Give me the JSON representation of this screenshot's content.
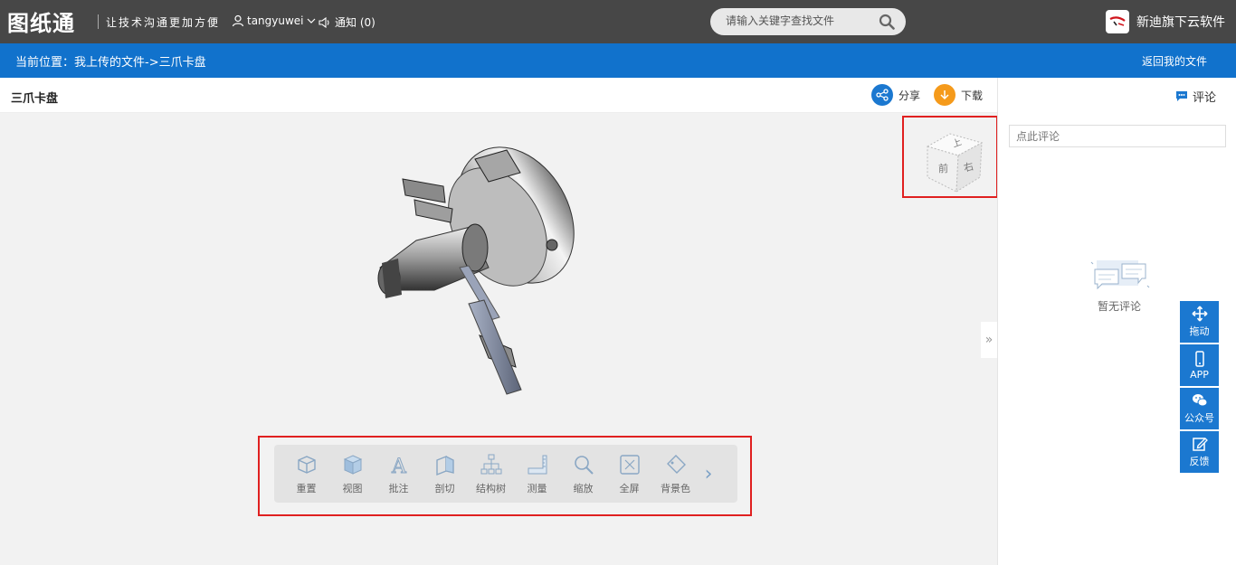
{
  "header": {
    "logo": "图纸通",
    "slogan": "让技术沟通更加方便",
    "username": "tangyuwei",
    "notification": "通知 (0)",
    "search_placeholder": "请输入关键字查找文件",
    "brand": "新迪旗下云软件"
  },
  "breadcrumb": {
    "text": "当前位置：我上传的文件->三爪卡盘",
    "back": "返回我的文件"
  },
  "viewer": {
    "file_title": "三爪卡盘",
    "share": "分享",
    "download": "下载",
    "cube_faces": {
      "top": "上",
      "front": "前",
      "right": "右"
    }
  },
  "toolbar": {
    "tools": [
      {
        "label": "重置",
        "icon": "reset-icon"
      },
      {
        "label": "视图",
        "icon": "view-cube-icon"
      },
      {
        "label": "批注",
        "icon": "annotate-icon"
      },
      {
        "label": "剖切",
        "icon": "section-icon"
      },
      {
        "label": "结构树",
        "icon": "tree-icon"
      },
      {
        "label": "测量",
        "icon": "measure-icon"
      },
      {
        "label": "缩放",
        "icon": "zoom-icon"
      },
      {
        "label": "全屏",
        "icon": "fullscreen-icon"
      },
      {
        "label": "背景色",
        "icon": "bgcolor-icon"
      }
    ]
  },
  "comments": {
    "tab": "评论",
    "placeholder": "点此评论",
    "empty": "暂无评论"
  },
  "float_bar": [
    {
      "label": "拖动",
      "icon": "move-icon"
    },
    {
      "label": "APP",
      "icon": "phone-icon"
    },
    {
      "label": "公众号",
      "icon": "wechat-icon"
    },
    {
      "label": "反馈",
      "icon": "feedback-icon"
    }
  ],
  "colors": {
    "topbar": "#474747",
    "accent": "#1172cc",
    "share": "#1b78d0",
    "download": "#f59a1b",
    "highlight": "#e02020"
  }
}
